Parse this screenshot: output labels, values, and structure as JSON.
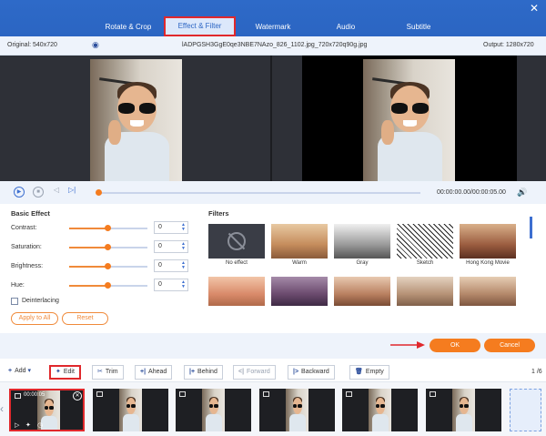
{
  "tabs": [
    "Rotate & Crop",
    "Effect & Filter",
    "Watermark",
    "Audio",
    "Subtitle"
  ],
  "active_tab": "Effect & Filter",
  "info": {
    "original": "Original: 540x720",
    "filename": "lADPGSH3GgE0qe3NBE7NAzo_826_1102.jpg_720x720q90g.jpg",
    "output": "Output: 1280x720"
  },
  "playback": {
    "time": "00:00:00.00/00:00:05.00",
    "progress": 0.0
  },
  "basic_effect": {
    "title": "Basic Effect",
    "params": [
      {
        "label": "Contrast:",
        "value": "0",
        "level": 0.5
      },
      {
        "label": "Saturation:",
        "value": "0",
        "level": 0.5
      },
      {
        "label": "Brightness:",
        "value": "0",
        "level": 0.5
      },
      {
        "label": "Hue:",
        "value": "0",
        "level": 0.5
      }
    ],
    "deinterlacing": "Deinterlacing",
    "apply_all": "Apply to All",
    "reset": "Reset"
  },
  "filters": {
    "title": "Filters",
    "items": [
      "No effect",
      "Warm",
      "Gray",
      "Sketch",
      "Hong Kong Movie",
      "",
      "",
      "",
      "",
      ""
    ]
  },
  "dialog": {
    "ok": "OK",
    "cancel": "Cancel"
  },
  "toolbar": {
    "add": "Add",
    "edit": "Edit",
    "trim": "Trim",
    "ahead": "Ahead",
    "behind": "Behind",
    "forward": "Forward",
    "backward": "Backward",
    "empty": "Empty",
    "page": "1 /6"
  },
  "timeline": {
    "clip1_time": "00:00:05"
  },
  "colors": {
    "accent": "#f57c1f",
    "primary": "#2e6ac8",
    "highlight": "#e0282c"
  }
}
